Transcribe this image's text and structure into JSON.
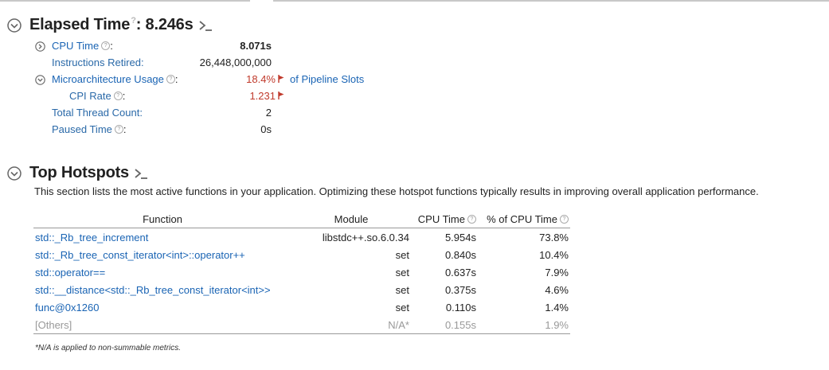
{
  "elapsed": {
    "title": "Elapsed Time",
    "value": ": 8.246s",
    "metrics": [
      {
        "label": "CPU Time",
        "value": "8.071s",
        "bold": true,
        "help": true,
        "colon": ":",
        "expandable": true
      },
      {
        "label": "Instructions Retired:",
        "value": "26,448,000,000"
      },
      {
        "label": "Microarchitecture Usage",
        "value": "18.4%",
        "suffix": "of Pipeline Slots",
        "help": true,
        "colon": ":",
        "expandable": true,
        "warning": true
      },
      {
        "label": "CPI Rate",
        "value": "1.231",
        "help": true,
        "colon": ":",
        "warning": true
      },
      {
        "label": "Total Thread Count:",
        "value": "2"
      },
      {
        "label": "Paused Time",
        "value": "0s",
        "help": true,
        "colon": ":"
      }
    ]
  },
  "hotspots": {
    "title": "Top Hotspots",
    "description": "This section lists the most active functions in your application. Optimizing these hotspot functions typically results in improving overall application performance.",
    "columns": [
      "Function",
      "Module",
      "CPU Time",
      "% of CPU Time"
    ],
    "rows": [
      {
        "function": "std::_Rb_tree_increment",
        "module": "libstdc++.so.6.0.34",
        "cpu_time": "5.954s",
        "percent": "73.8%"
      },
      {
        "function": "std::_Rb_tree_const_iterator<int>::operator++",
        "module": "set",
        "cpu_time": "0.840s",
        "percent": "10.4%"
      },
      {
        "function": "std::operator==",
        "module": "set",
        "cpu_time": "0.637s",
        "percent": "7.9%"
      },
      {
        "function": "std::__distance<std::_Rb_tree_const_iterator<int>>",
        "module": "set",
        "cpu_time": "0.375s",
        "percent": "4.6%"
      },
      {
        "function": "func@0x1260",
        "module": "set",
        "cpu_time": "0.110s",
        "percent": "1.4%"
      },
      {
        "function": "[Others]",
        "module": "N/A*",
        "cpu_time": "0.155s",
        "percent": "1.9%"
      }
    ],
    "footnote": "*N/A is applied to non-summable metrics."
  },
  "colors": {
    "link": "#1a64b4",
    "warning": "#c0392b",
    "muted": "#999999"
  },
  "icons": [
    "collapse-circle-icon",
    "command-line-icon",
    "help-icon",
    "expand-circle-icon",
    "warning-flag-icon"
  ]
}
